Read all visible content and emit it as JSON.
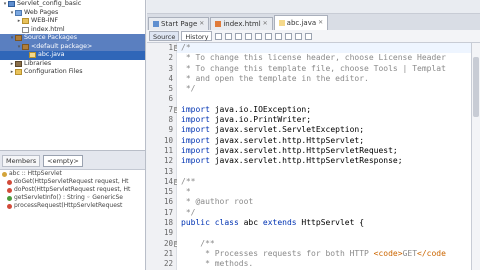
{
  "project_tree": [
    {
      "label": "Servlet_config_basic",
      "icon": "proj",
      "indent": 0,
      "toggle": "▾",
      "state": ""
    },
    {
      "label": "Web Pages",
      "icon": "web",
      "indent": 1,
      "toggle": "▾",
      "state": ""
    },
    {
      "label": "WEB-INF",
      "icon": "fold",
      "indent": 2,
      "toggle": "▸",
      "state": ""
    },
    {
      "label": "index.html",
      "icon": "file",
      "indent": 2,
      "toggle": "",
      "state": ""
    },
    {
      "label": "Source Packages",
      "icon": "pkg",
      "indent": 1,
      "toggle": "▾",
      "state": "sel2"
    },
    {
      "label": "<default package>",
      "icon": "pkg",
      "indent": 2,
      "toggle": "▾",
      "state": "sel2"
    },
    {
      "label": "abc.java",
      "icon": "java",
      "indent": 3,
      "toggle": "",
      "state": "sel"
    },
    {
      "label": "Libraries",
      "icon": "jar",
      "indent": 1,
      "toggle": "▸",
      "state": ""
    },
    {
      "label": "Configuration Files",
      "icon": "fold",
      "indent": 1,
      "toggle": "▸",
      "state": ""
    }
  ],
  "navigator": {
    "tab_label": "Members",
    "filter_value": "<empty>",
    "items": [
      {
        "label": "abc :: HttpServlet",
        "icon": "y",
        "indent": 0
      },
      {
        "label": "doGet(HttpServletRequest request, Ht",
        "icon": "r",
        "indent": 1
      },
      {
        "label": "doPost(HttpServletRequest request, Ht",
        "icon": "r",
        "indent": 1
      },
      {
        "label": "getServletInfo() : String ◦ GenericSe",
        "icon": "g",
        "indent": 1
      },
      {
        "label": "processRequest(HttpServletRequest",
        "icon": "r",
        "indent": 1
      }
    ]
  },
  "editor_tabs": [
    {
      "label": "Start Page",
      "active": false
    },
    {
      "label": "index.html",
      "active": false
    },
    {
      "label": "abc.java",
      "active": true
    }
  ],
  "editor_toolbar": {
    "source_label": "Source",
    "history_label": "History"
  },
  "code_lines": [
    {
      "n": "1",
      "fold": "⊟",
      "html": "<span class=\"cm\">/*</span>"
    },
    {
      "n": "2",
      "fold": "",
      "html": "<span class=\"cm\"> * To change this license header, choose License Header</span>"
    },
    {
      "n": "3",
      "fold": "",
      "html": "<span class=\"cm\"> * To change this template file, choose Tools | Templat</span>"
    },
    {
      "n": "4",
      "fold": "",
      "html": "<span class=\"cm\"> * and open the template in the editor.</span>"
    },
    {
      "n": "5",
      "fold": "",
      "html": "<span class=\"cm\"> */</span>"
    },
    {
      "n": "6",
      "fold": "",
      "html": ""
    },
    {
      "n": "7",
      "fold": "⊟",
      "html": "<span class=\"kw\">import</span> java.io.IOException;"
    },
    {
      "n": "8",
      "fold": "",
      "html": "<span class=\"kw\">import</span> java.io.PrintWriter;"
    },
    {
      "n": "9",
      "fold": "",
      "html": "<span class=\"kw\">import</span> javax.servlet.ServletException;"
    },
    {
      "n": "10",
      "fold": "",
      "html": "<span class=\"kw\">import</span> javax.servlet.http.HttpServlet;"
    },
    {
      "n": "11",
      "fold": "",
      "html": "<span class=\"kw\">import</span> javax.servlet.http.HttpServletRequest;"
    },
    {
      "n": "12",
      "fold": "",
      "html": "<span class=\"kw\">import</span> javax.servlet.http.HttpServletResponse;"
    },
    {
      "n": "13",
      "fold": "",
      "html": ""
    },
    {
      "n": "14",
      "fold": "⊟",
      "html": "<span class=\"cm\">/**</span>"
    },
    {
      "n": "15",
      "fold": "",
      "html": "<span class=\"cm\"> *</span>"
    },
    {
      "n": "16",
      "fold": "",
      "html": "<span class=\"cm\"> * @author root</span>"
    },
    {
      "n": "17",
      "fold": "",
      "html": "<span class=\"cm\"> */</span>"
    },
    {
      "n": "18",
      "fold": "",
      "html": "<span class=\"kw\">public class</span> abc <span class=\"kw\">extends</span> HttpServlet {"
    },
    {
      "n": "19",
      "fold": "",
      "html": ""
    },
    {
      "n": "20",
      "fold": "⊟",
      "html": "    <span class=\"cm\">/**</span>"
    },
    {
      "n": "21",
      "fold": "",
      "html": "<span class=\"cm\">     * Processes requests for both HTTP </span><span class=\"tg\">&lt;code&gt;</span><span class=\"cm\">GET</span><span class=\"tg\">&lt;/code</span>"
    },
    {
      "n": "22",
      "fold": "",
      "html": "<span class=\"cm\">     * methods.</span>"
    }
  ]
}
